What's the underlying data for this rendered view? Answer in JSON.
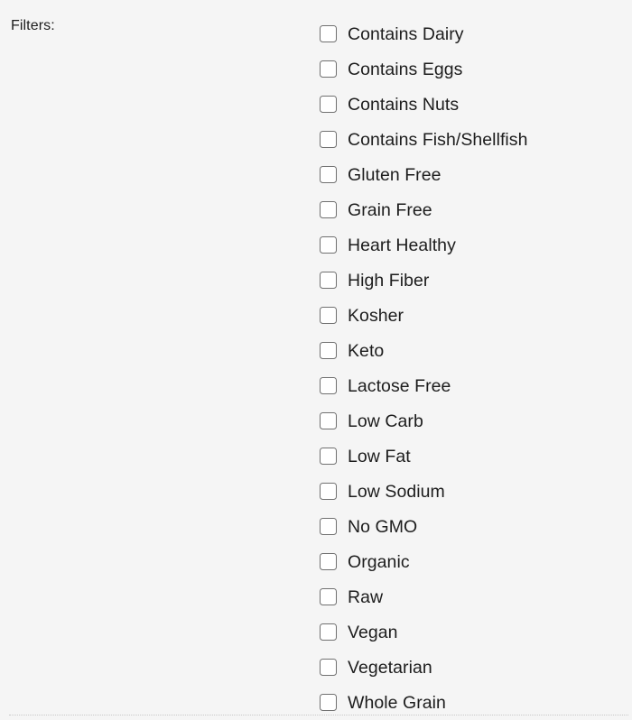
{
  "panel": {
    "label": "Filters:",
    "accent_color": "#707070",
    "background_color": "#f5f5f5",
    "text_color": "#1d1d1d",
    "checkbox_fill": "#ffffff",
    "divider_color": "#c8c8c8"
  },
  "options": [
    {
      "label": "Contains Dairy",
      "checked": false
    },
    {
      "label": "Contains Eggs",
      "checked": false
    },
    {
      "label": "Contains Nuts",
      "checked": false
    },
    {
      "label": "Contains Fish/Shellfish",
      "checked": false
    },
    {
      "label": "Gluten Free",
      "checked": false
    },
    {
      "label": "Grain Free",
      "checked": false
    },
    {
      "label": "Heart Healthy",
      "checked": false
    },
    {
      "label": "High Fiber",
      "checked": false
    },
    {
      "label": "Kosher",
      "checked": false
    },
    {
      "label": "Keto",
      "checked": false
    },
    {
      "label": "Lactose Free",
      "checked": false
    },
    {
      "label": "Low Carb",
      "checked": false
    },
    {
      "label": "Low Fat",
      "checked": false
    },
    {
      "label": "Low Sodium",
      "checked": false
    },
    {
      "label": "No GMO",
      "checked": false
    },
    {
      "label": "Organic",
      "checked": false
    },
    {
      "label": "Raw",
      "checked": false
    },
    {
      "label": "Vegan",
      "checked": false
    },
    {
      "label": "Vegetarian",
      "checked": false
    },
    {
      "label": "Whole Grain",
      "checked": false
    }
  ]
}
